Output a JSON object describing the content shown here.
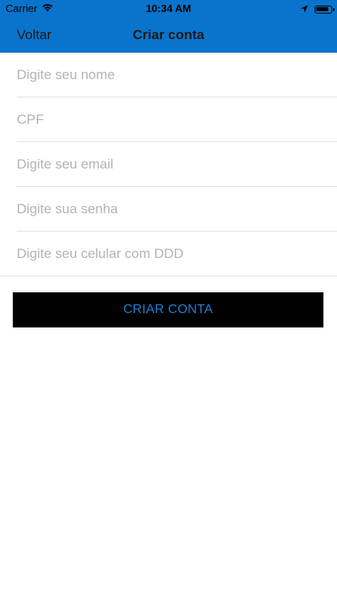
{
  "status_bar": {
    "carrier": "Carrier",
    "time": "10:34 AM",
    "battery_level": 0.9,
    "icons": [
      "wifi-icon",
      "location-arrow-icon",
      "battery-icon"
    ]
  },
  "nav": {
    "back_label": "Voltar",
    "title": "Criar conta"
  },
  "form": {
    "fields": [
      {
        "placeholder": "Digite seu nome",
        "value": ""
      },
      {
        "placeholder": "CPF",
        "value": ""
      },
      {
        "placeholder": "Digite seu email",
        "value": ""
      },
      {
        "placeholder": "Digite sua senha",
        "value": ""
      },
      {
        "placeholder": "Digite seu celular com DDD",
        "value": ""
      }
    ],
    "submit_label": "CRIAR CONTA"
  },
  "colors": {
    "header_bg": "#0a74cc",
    "button_bg": "#000000",
    "button_text": "#1f7fd6",
    "placeholder": "#b3b3b8"
  }
}
